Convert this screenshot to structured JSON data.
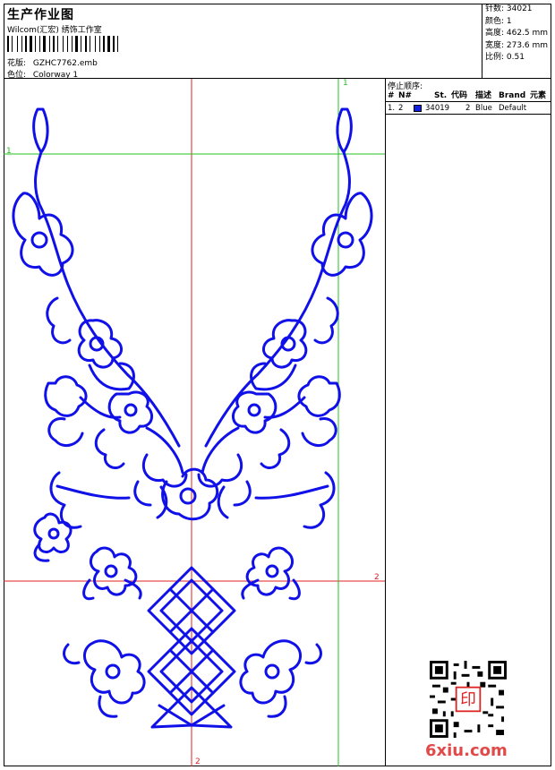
{
  "header": {
    "title": "生产作业图",
    "subtitle": "Wilcom(汇宏) 绣饰工作室",
    "design_label": "花版:",
    "design_value": "GZHC7762.emb",
    "colorway_label": "色位:",
    "colorway_value": "Colorway 1"
  },
  "info": {
    "stitches": "针数: 34021",
    "colors": "颜色: 1",
    "height": "高度: 462.5 mm",
    "width": "宽度: 273.6 mm",
    "scale": "比例: 0.51"
  },
  "stop_sequence": {
    "title": "停止顺序:",
    "columns": [
      "#",
      "N#",
      "St.",
      "代码",
      "描述",
      "Brand",
      "元素"
    ],
    "rows": [
      {
        "num": "1.",
        "needle": "2",
        "stitches": "34019",
        "code": "2",
        "desc": "Blue",
        "brand": "Default",
        "color": "#1020e0"
      }
    ]
  },
  "reference_labels": {
    "a": "1",
    "b": "1",
    "c": "2",
    "d": "2"
  },
  "colors": {
    "thread": "#1010e8",
    "guide_red": "#e02020",
    "guide_green": "#20c020"
  },
  "watermark": "6xiu.com",
  "qr_stamp": "印"
}
